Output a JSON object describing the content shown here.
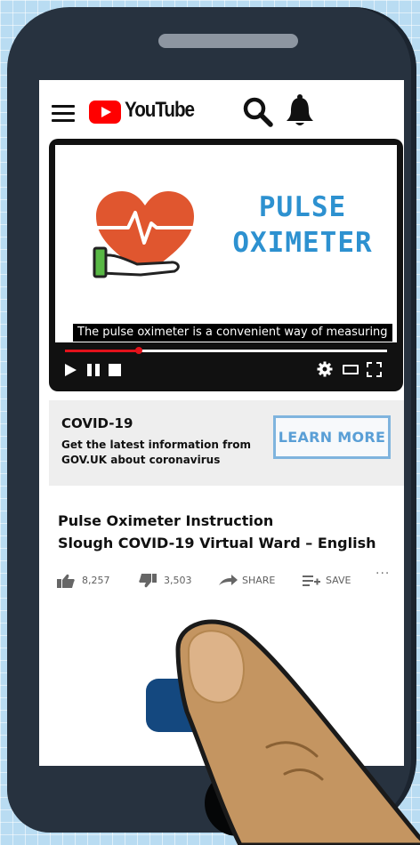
{
  "app": {
    "brand": "YouTube"
  },
  "colors": {
    "brand_red": "#ff0000",
    "accent_blue": "#2d91d0",
    "phone_body": "#27323f",
    "subscribe_blue": "#14487f"
  },
  "video": {
    "title_line1": "PULSE",
    "title_line2": "OXIMETER",
    "caption": "The pulse oximeter is a convenient way of measuring",
    "progress": 0.23
  },
  "banner": {
    "title": "COVID-19",
    "text": "Get the latest information from GOV.UK about coronavirus",
    "button_label": "LEARN MORE"
  },
  "video_info": {
    "title_line1": "Pulse Oximeter Instruction",
    "title_line2": "Slough COVID-19 Virtual Ward – English"
  },
  "actions": {
    "likes": "8,257",
    "dislikes": "3,503",
    "share_label": "SHARE",
    "save_label": "SAVE",
    "more_label": "···"
  },
  "icons": [
    "menu-icon",
    "youtube-logo-icon",
    "search-icon",
    "bell-icon",
    "heart-pulse-icon",
    "play-icon",
    "pause-icon",
    "stop-icon",
    "gear-icon",
    "theater-icon",
    "fullscreen-icon",
    "thumbs-up-icon",
    "thumbs-down-icon",
    "share-icon",
    "save-icon",
    "finger-icon"
  ]
}
